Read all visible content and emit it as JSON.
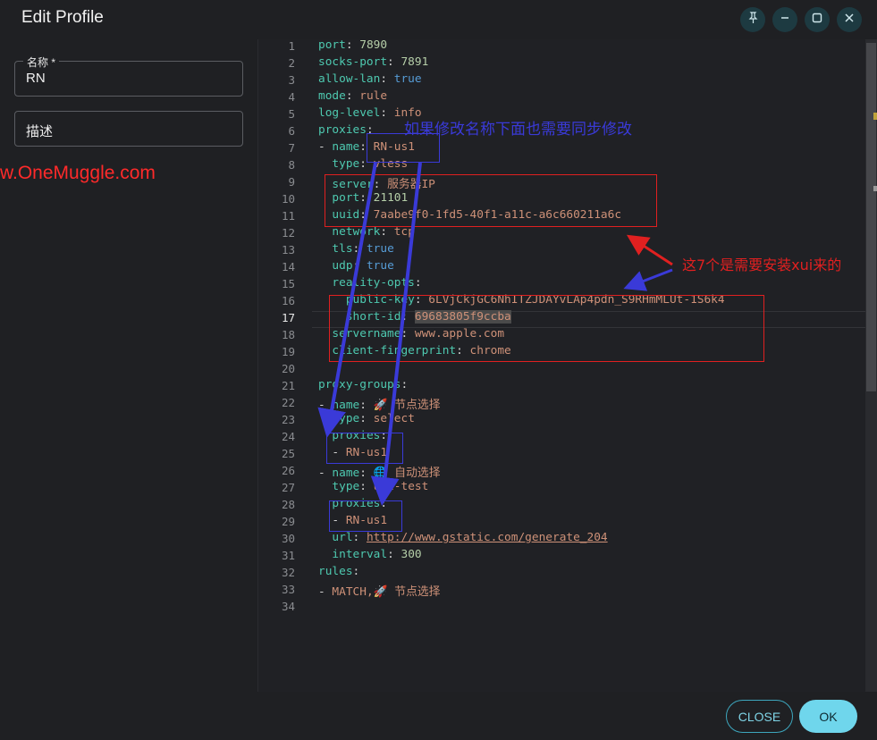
{
  "window": {
    "title": "Edit Profile"
  },
  "window_controls": {
    "pin": "📌",
    "minimize": "—",
    "maximize": "□",
    "close": "✕"
  },
  "form": {
    "name": {
      "label": "名称 *",
      "value": "RN"
    },
    "description": {
      "label": "描述"
    }
  },
  "watermark": "w.OneMuggle.com",
  "editor": {
    "lines": [
      [
        [
          "k",
          "port"
        ],
        [
          "d",
          ": "
        ],
        [
          "n",
          "7890"
        ]
      ],
      [
        [
          "k",
          "socks-port"
        ],
        [
          "d",
          ": "
        ],
        [
          "n",
          "7891"
        ]
      ],
      [
        [
          "k",
          "allow-lan"
        ],
        [
          "d",
          ": "
        ],
        [
          "b",
          "true"
        ]
      ],
      [
        [
          "k",
          "mode"
        ],
        [
          "d",
          ": "
        ],
        [
          "v",
          "rule"
        ]
      ],
      [
        [
          "k",
          "log-level"
        ],
        [
          "d",
          ": "
        ],
        [
          "v",
          "info"
        ]
      ],
      [
        [
          "k",
          "proxies"
        ],
        [
          "d",
          ":"
        ]
      ],
      [
        [
          "d",
          "- "
        ],
        [
          "k",
          "name"
        ],
        [
          "d",
          ": "
        ],
        [
          "v",
          "RN-us1"
        ]
      ],
      [
        [
          "d",
          "  "
        ],
        [
          "k",
          "type"
        ],
        [
          "d",
          ": "
        ],
        [
          "v",
          "vless"
        ]
      ],
      [
        [
          "d",
          "  "
        ],
        [
          "k",
          "server"
        ],
        [
          "d",
          ": "
        ],
        [
          "v",
          "服务器IP"
        ]
      ],
      [
        [
          "d",
          "  "
        ],
        [
          "k",
          "port"
        ],
        [
          "d",
          ": "
        ],
        [
          "n",
          "21101"
        ]
      ],
      [
        [
          "d",
          "  "
        ],
        [
          "k",
          "uuid"
        ],
        [
          "d",
          ": "
        ],
        [
          "v",
          "7aabe9f0-1fd5-40f1-a11c-a6c660211a6c"
        ]
      ],
      [
        [
          "d",
          "  "
        ],
        [
          "k",
          "network"
        ],
        [
          "d",
          ": "
        ],
        [
          "v",
          "tcp"
        ]
      ],
      [
        [
          "d",
          "  "
        ],
        [
          "k",
          "tls"
        ],
        [
          "d",
          ": "
        ],
        [
          "b",
          "true"
        ]
      ],
      [
        [
          "d",
          "  "
        ],
        [
          "k",
          "udp"
        ],
        [
          "d",
          ": "
        ],
        [
          "b",
          "true"
        ]
      ],
      [
        [
          "d",
          "  "
        ],
        [
          "k",
          "reality-opts"
        ],
        [
          "d",
          ":"
        ]
      ],
      [
        [
          "d",
          "    "
        ],
        [
          "k",
          "public-key"
        ],
        [
          "d",
          ": "
        ],
        [
          "v",
          "6LVjCkjGC6NhITZJDAYvLAp4pdn_S9RHmMLUt-1S6k4"
        ]
      ],
      [
        [
          "d",
          "    "
        ],
        [
          "k",
          "short-id"
        ],
        [
          "d",
          ": "
        ],
        [
          "vh",
          "69683805f9ccba"
        ]
      ],
      [
        [
          "d",
          "  "
        ],
        [
          "k",
          "servername"
        ],
        [
          "d",
          ": "
        ],
        [
          "v",
          "www.apple.com"
        ]
      ],
      [
        [
          "d",
          "  "
        ],
        [
          "k",
          "client-fingerprint"
        ],
        [
          "d",
          ": "
        ],
        [
          "v",
          "chrome"
        ]
      ],
      [],
      [
        [
          "k",
          "proxy-groups"
        ],
        [
          "d",
          ":"
        ]
      ],
      [
        [
          "d",
          "- "
        ],
        [
          "k",
          "name"
        ],
        [
          "d",
          ": "
        ],
        [
          "v",
          "🚀 节点选择"
        ]
      ],
      [
        [
          "d",
          "  "
        ],
        [
          "k",
          "type"
        ],
        [
          "d",
          ": "
        ],
        [
          "v",
          "select"
        ]
      ],
      [
        [
          "d",
          "  "
        ],
        [
          "k",
          "proxies"
        ],
        [
          "d",
          ":"
        ]
      ],
      [
        [
          "d",
          "  - "
        ],
        [
          "v",
          "RN-us1"
        ]
      ],
      [
        [
          "d",
          "- "
        ],
        [
          "k",
          "name"
        ],
        [
          "d",
          ": "
        ],
        [
          "v",
          "🌐 自动选择"
        ]
      ],
      [
        [
          "d",
          "  "
        ],
        [
          "k",
          "type"
        ],
        [
          "d",
          ": "
        ],
        [
          "v",
          "url-test"
        ]
      ],
      [
        [
          "d",
          "  "
        ],
        [
          "k",
          "proxies"
        ],
        [
          "d",
          ":"
        ]
      ],
      [
        [
          "d",
          "  - "
        ],
        [
          "v",
          "RN-us1"
        ]
      ],
      [
        [
          "d",
          "  "
        ],
        [
          "k",
          "url"
        ],
        [
          "d",
          ": "
        ],
        [
          "u",
          "http://www.gstatic.com/generate_204"
        ]
      ],
      [
        [
          "d",
          "  "
        ],
        [
          "k",
          "interval"
        ],
        [
          "d",
          ": "
        ],
        [
          "n",
          "300"
        ]
      ],
      [
        [
          "k",
          "rules"
        ],
        [
          "d",
          ":"
        ]
      ],
      [
        [
          "d",
          "- "
        ],
        [
          "v",
          "MATCH,🚀 节点选择"
        ]
      ],
      []
    ],
    "active_line": 17
  },
  "annotations": {
    "rename_note": "如果修改名称下面也需要同步修改",
    "install_note": "这7个是需要安装xui来的"
  },
  "footer": {
    "close_label": "CLOSE",
    "ok_label": "OK"
  },
  "colors": {
    "accent": "#6fd6ec",
    "annotation_red": "#e02020",
    "annotation_blue": "#3a3ad8"
  }
}
